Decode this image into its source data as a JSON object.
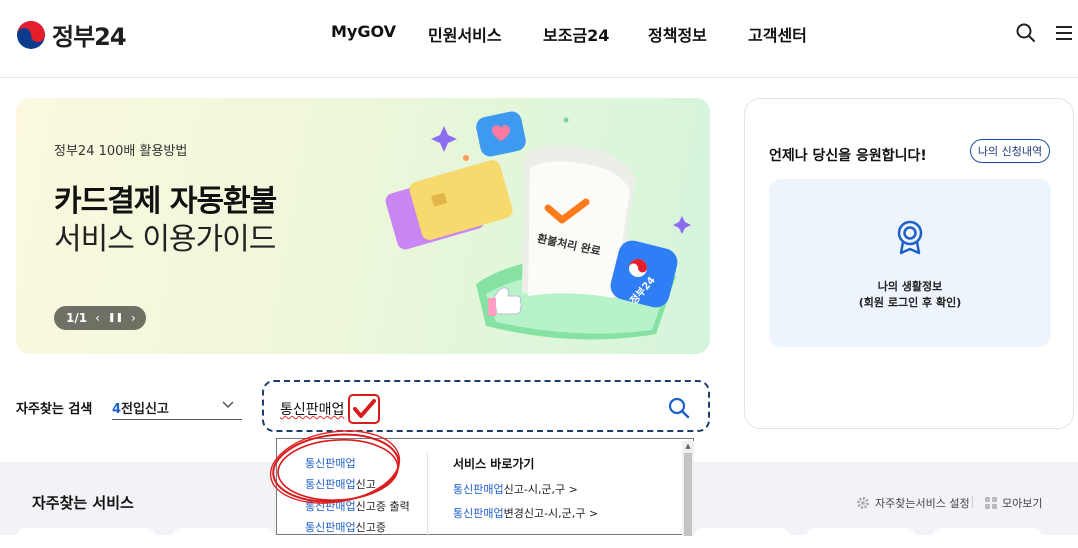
{
  "header": {
    "logo_text": "정부24",
    "nav": [
      "MyGOV",
      "민원서비스",
      "보조금24",
      "정책정보",
      "고객센터"
    ],
    "icons": [
      "search-icon",
      "menu-icon"
    ]
  },
  "banner": {
    "subtitle": "정부24 100배 활용방법",
    "title": "카드결제 자동환불",
    "title2": "서비스 이용가이드",
    "pager": "1/1",
    "receipt_text": "환불처리 완료",
    "badge_text": "정부24"
  },
  "side": {
    "title": "언제나 당신을 응원합니다!",
    "button": "나의 신청내역",
    "info_line1": "나의 생활정보",
    "info_line2": "(회원 로그인 후 확인)"
  },
  "search": {
    "frequent_label": "자주찾는 검색",
    "frequent_num": "4",
    "frequent_value": "전입신고",
    "input_value": "통신판매업"
  },
  "autocomplete": {
    "items": [
      {
        "hl": "통신판매업",
        "rest": ""
      },
      {
        "hl": "통신판매업",
        "rest": "신고"
      },
      {
        "hl": "통신판매업",
        "rest": "신고증 출력"
      },
      {
        "hl": "통신판매업",
        "rest": "신고증"
      }
    ],
    "shortcut_title": "서비스 바로가기",
    "links": [
      {
        "hl": "통신판매업",
        "rest": "신고-시,군,구 >"
      },
      {
        "hl": "통신판매업",
        "rest": "변경신고-시,군,구 >"
      }
    ]
  },
  "bottom": {
    "title": "자주찾는 서비스",
    "setting": "자주찾는서비스 설정",
    "collect": "모아보기"
  },
  "colors": {
    "accent_blue": "#1e60c9",
    "dark_navy": "#1d3d6c",
    "annotation_red": "#d81b1b"
  }
}
